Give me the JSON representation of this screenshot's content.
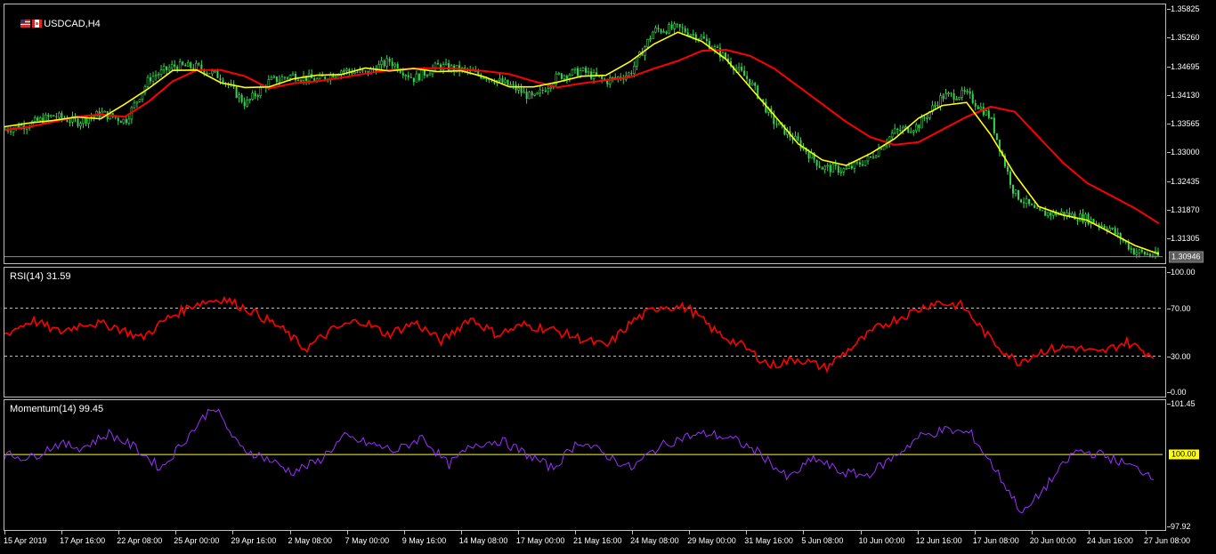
{
  "window": {
    "symbol_title": "USDCAD,H4"
  },
  "colors": {
    "bull": "#39d353",
    "bear": "#39d353",
    "ma_fast": "#ffff00",
    "ma_slow": "#ff0000",
    "rsi": "#ff0000",
    "momentum": "#9a30ff",
    "momentum_level": "#ffff00",
    "axis": "#bdbdbd"
  },
  "main_chart": {
    "current_price_label": "1.30946",
    "y_ticks": [
      "1.35825",
      "1.35260",
      "1.34695",
      "1.34130",
      "1.33565",
      "1.33000",
      "1.32435",
      "1.31870",
      "1.31305"
    ]
  },
  "rsi_panel": {
    "title": "RSI(14) 31.59",
    "y_ticks": [
      "100.00",
      "70.00",
      "30.00",
      "0.00"
    ]
  },
  "momentum_panel": {
    "title": "Momentum(14) 99.45",
    "y_ticks": [
      "101.45",
      "97.92"
    ],
    "level_label": "100.00"
  },
  "x_ticks": [
    "15 Apr 2019",
    "17 Apr 16:00",
    "22 Apr 08:00",
    "25 Apr 00:00",
    "29 Apr 16:00",
    "2 May 08:00",
    "7 May 00:00",
    "9 May 16:00",
    "14 May 08:00",
    "17 May 00:00",
    "21 May 16:00",
    "24 May 08:00",
    "29 May 00:00",
    "31 May 16:00",
    "5 Jun 08:00",
    "10 Jun 00:00",
    "12 Jun 16:00",
    "17 Jun 08:00",
    "20 Jun 00:00",
    "24 Jun 16:00",
    "27 Jun 08:00"
  ],
  "chart_data": [
    {
      "type": "line",
      "title": "USDCAD,H4",
      "ylim": [
        1.3087,
        1.3586
      ],
      "x_labels": [
        "15 Apr 2019",
        "17 Apr 16:00",
        "22 Apr 08:00",
        "25 Apr 00:00",
        "29 Apr 16:00",
        "2 May 08:00",
        "7 May 00:00",
        "9 May 16:00",
        "14 May 08:00",
        "17 May 00:00",
        "21 May 16:00",
        "24 May 08:00",
        "29 May 00:00",
        "31 May 16:00",
        "5 Jun 08:00",
        "10 Jun 00:00",
        "12 Jun 16:00",
        "17 Jun 08:00",
        "20 Jun 00:00",
        "24 Jun 16:00",
        "27 Jun 08:00"
      ],
      "series": [
        {
          "values": [
            1.3345,
            1.3356,
            1.3372,
            1.336,
            1.3377,
            1.3362,
            1.3446,
            1.347,
            1.3468,
            1.3448,
            1.3395,
            1.344,
            1.3452,
            1.3442,
            1.3462,
            1.3456,
            1.348,
            1.3445,
            1.347,
            1.3462,
            1.345,
            1.3432,
            1.3405,
            1.345,
            1.346,
            1.344,
            1.3455,
            1.354,
            1.3545,
            1.3525,
            1.3485,
            1.344,
            1.336,
            1.332,
            1.327,
            1.3265,
            1.3288,
            1.334,
            1.3352,
            1.341,
            1.3415,
            1.337,
            1.322,
            1.318,
            1.318,
            1.317,
            1.315,
            1.3105,
            1.3095
          ]
        },
        {
          "values": [
            1.3344,
            1.335,
            1.336,
            1.337,
            1.3375,
            1.337,
            1.34,
            1.344,
            1.3462,
            1.3462,
            1.345,
            1.3426,
            1.3436,
            1.344,
            1.3447,
            1.3455,
            1.3462,
            1.3465,
            1.3466,
            1.3464,
            1.346,
            1.3454,
            1.344,
            1.3428,
            1.3436,
            1.3442,
            1.3448,
            1.3465,
            1.348,
            1.35,
            1.3502,
            1.349,
            1.3465,
            1.343,
            1.3395,
            1.336,
            1.333,
            1.3315,
            1.332,
            1.3345,
            1.337,
            1.339,
            1.338,
            1.333,
            1.328,
            1.324,
            1.3215,
            1.319,
            1.316
          ]
        }
      ]
    },
    {
      "type": "line",
      "title": "RSI(14) 31.59",
      "ylim": [
        0,
        100
      ],
      "x": [
        0,
        4,
        8,
        12,
        16,
        20,
        24,
        28,
        32,
        36,
        40,
        44,
        48,
        52,
        56,
        60,
        64,
        68,
        72,
        76,
        80,
        84,
        88,
        92,
        96,
        100
      ],
      "series": [
        {
          "values": [
            48,
            60,
            50,
            58,
            55,
            45,
            62,
            74,
            78,
            68,
            55,
            36,
            52,
            60,
            48,
            58,
            42,
            62,
            48,
            56,
            52,
            45,
            38,
            60,
            72,
            70,
            50,
            38,
            22,
            28,
            20,
            38,
            55,
            65,
            75,
            72,
            45,
            25,
            35,
            38,
            32,
            42,
            30
          ]
        }
      ],
      "levels": [
        70,
        30
      ]
    },
    {
      "type": "line",
      "title": "Momentum(14) 99.45",
      "ylim": [
        97.92,
        101.45
      ],
      "series": [
        {
          "values": [
            100.0,
            99.9,
            100.3,
            100.2,
            100.6,
            100.2,
            99.6,
            100.5,
            101.4,
            100.2,
            99.9,
            99.5,
            99.8,
            100.5,
            100.3,
            100.1,
            100.5,
            99.7,
            100.3,
            100.4,
            100.0,
            99.6,
            100.4,
            100.0,
            99.6,
            100.2,
            100.5,
            100.6,
            100.4,
            100.0,
            99.3,
            99.9,
            99.5,
            99.4,
            99.9,
            100.5,
            100.7,
            100.6,
            99.5,
            98.3,
            99.2,
            100.1,
            100.0,
            99.7,
            99.4
          ]
        }
      ],
      "levels": [
        100.0
      ]
    }
  ]
}
